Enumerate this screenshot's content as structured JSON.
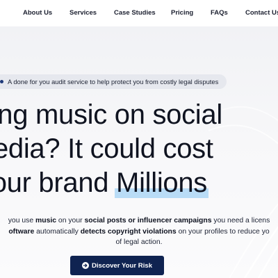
{
  "nav": {
    "items": [
      {
        "label": "About Us"
      },
      {
        "label": "Services"
      },
      {
        "label": "Case Studies"
      },
      {
        "label": "Pricing"
      },
      {
        "label": "FAQs"
      },
      {
        "label": "Contact Us"
      }
    ]
  },
  "hero": {
    "badge_text": "A done for you audit service to help protect you from costly legal disputes",
    "headline": {
      "line1": "sing music on social",
      "line2": "nedia? It could cost",
      "line3_prefix": "your brand ",
      "line3_highlight": "Millions"
    },
    "subcopy": {
      "l1_a": "you use ",
      "l1_b": "music",
      "l1_c": " on your ",
      "l1_d": "social posts or influencer campaigns",
      "l1_e": " you need a licens",
      "l2_a": "oftware",
      "l2_b": " automatically ",
      "l2_c": "detects copyright violations",
      "l2_d": " on your profiles to reduce yo",
      "l3": "of legal action."
    },
    "cta_label": "Discover Your Risk",
    "cta_icon": "arrow-circle-right-icon"
  },
  "colors": {
    "accent": "#0f2351",
    "highlight": "#b9dcf6",
    "badge_bg": "#e6e8ee",
    "text": "#0f1320"
  }
}
